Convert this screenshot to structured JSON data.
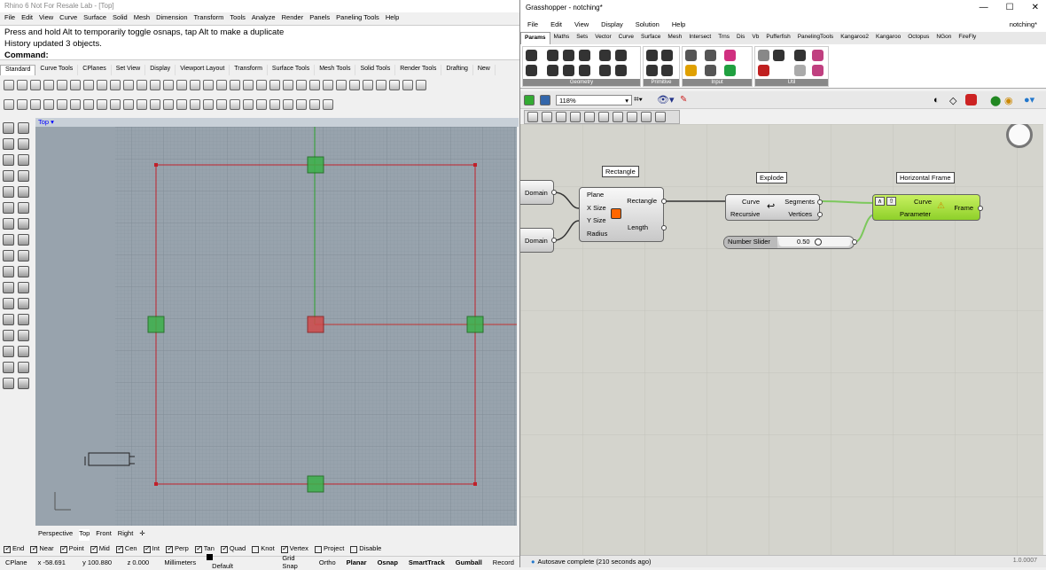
{
  "rhino": {
    "title": "Rhino 6 Not For Resale Lab - [Top]",
    "menu": [
      "File",
      "Edit",
      "View",
      "Curve",
      "Surface",
      "Solid",
      "Mesh",
      "Dimension",
      "Transform",
      "Tools",
      "Analyze",
      "Render",
      "Panels",
      "Paneling Tools",
      "Help"
    ],
    "cmd_line1": "Press and hold Alt to temporarily toggle osnaps, tap Alt to make a duplicate",
    "cmd_line2": "History updated 3 objects.",
    "cmd_prompt": "Command:",
    "tabs": [
      "Standard",
      "Curve Tools",
      "CPlanes",
      "Set View",
      "Display",
      "Viewport Layout",
      "Transform",
      "Surface Tools",
      "Mesh Tools",
      "Solid Tools",
      "Render Tools",
      "Drafting",
      "New"
    ],
    "viewport_label": "Top",
    "viewport_tabs": [
      "Perspective",
      "Top",
      "Front",
      "Right"
    ],
    "osnaps": [
      {
        "label": "End",
        "checked": true
      },
      {
        "label": "Near",
        "checked": true
      },
      {
        "label": "Point",
        "checked": true
      },
      {
        "label": "Mid",
        "checked": true
      },
      {
        "label": "Cen",
        "checked": true
      },
      {
        "label": "Int",
        "checked": true
      },
      {
        "label": "Perp",
        "checked": true
      },
      {
        "label": "Tan",
        "checked": true
      },
      {
        "label": "Quad",
        "checked": true
      },
      {
        "label": "Knot",
        "checked": false
      },
      {
        "label": "Vertex",
        "checked": true
      },
      {
        "label": "Project",
        "checked": false
      },
      {
        "label": "Disable",
        "checked": false
      }
    ],
    "status": {
      "cplane": "CPlane",
      "x": "x -58.691",
      "y": "y 100.880",
      "z": "z 0.000",
      "units": "Millimeters",
      "layer": "Default",
      "grid_snap": "Grid Snap",
      "ortho": "Ortho",
      "planar": "Planar",
      "osnap": "Osnap",
      "smarttrack": "SmartTrack",
      "gumball": "Gumball",
      "record": "Record"
    }
  },
  "gh": {
    "title": "Grasshopper - notching*",
    "doc_name": "notching*",
    "menu": [
      "File",
      "Edit",
      "View",
      "Display",
      "Solution",
      "Help"
    ],
    "tabs": [
      "Params",
      "Maths",
      "Sets",
      "Vector",
      "Curve",
      "Surface",
      "Mesh",
      "Intersect",
      "Trns",
      "Dis",
      "Vb",
      "Pufferfish",
      "PanelingTools",
      "Kangaroo2",
      "Kangaroo",
      "Octopus",
      "NGon",
      "FireFly"
    ],
    "ribbon_groups": [
      "Geometry",
      "Primitive",
      "Input",
      "Util"
    ],
    "zoom": "118%",
    "status": "Autosave complete (210 seconds ago)",
    "version": "1.0.0007",
    "nodes": {
      "domain1": "Domain",
      "domain2": "Domain",
      "rectangle": {
        "label": "Rectangle",
        "in": [
          "Plane",
          "X Size",
          "Y Size",
          "Radius"
        ],
        "out": [
          "Rectangle",
          "Length"
        ]
      },
      "explode": {
        "label": "Explode",
        "in": [
          "Curve",
          "Recursive"
        ],
        "out": [
          "Segments",
          "Vertices"
        ]
      },
      "hframe": {
        "label": "Horizontal Frame",
        "in": [
          "Curve",
          "Parameter"
        ],
        "out": [
          "Frame"
        ]
      },
      "slider": {
        "name": "Number Slider",
        "value": "0.50"
      }
    }
  }
}
